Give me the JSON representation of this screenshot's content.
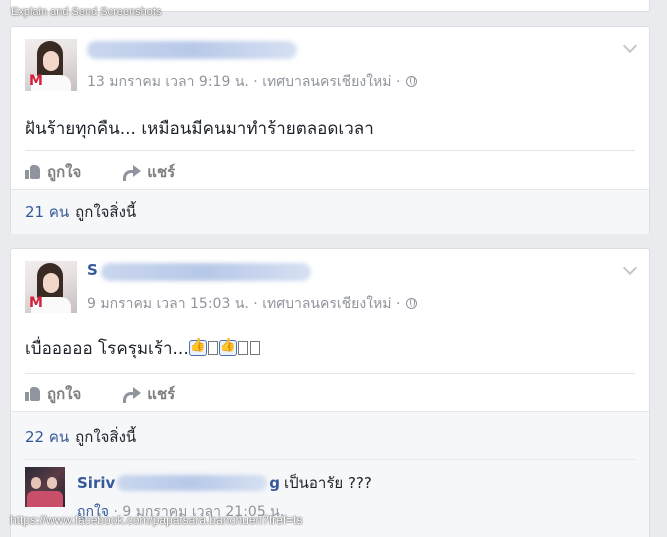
{
  "watermark": {
    "top": "Explain and Send Screenshots",
    "bottom": "https://www.facebook.com/papatsara.banchuen?fref=ts"
  },
  "post1": {
    "name_visible": "",
    "timestamp": "13 มกราคม เวลา 9:19 น.",
    "location": " · เทศบาลนครเชียงใหม่ ·",
    "text": "ฝันร้ายทุกคืน... เหมือนมีคนมาทำร้ายตลอดเวลา",
    "like_label": "ถูกใจ",
    "share_label": "แชร์",
    "likes_count": "21 คน",
    "likes_text": "ถูกใจสิ่งนี้"
  },
  "post2": {
    "name_visible": "S",
    "timestamp": "9 มกราคม เวลา 15:03 น.",
    "location": " · เทศบาลนครเชียงใหม่ ·",
    "text": "เบื่อออออ โรครุมเร้า...",
    "like_label": "ถูกใจ",
    "share_label": "แชร์",
    "likes_count": "22 คน",
    "likes_text": "ถูกใจสิ่งนี้",
    "comment": {
      "name_start": "Siriv",
      "name_end": "g",
      "text": "เป็นอารัย ???",
      "like_label": "ถูกใจ",
      "time": " · 9 มกราคม เวลา 21:05 น."
    }
  },
  "icons": {
    "like": "thumbs-up-icon",
    "share": "share-arrow-icon",
    "privacy": "globe-icon",
    "menu": "chevron-down-icon"
  },
  "colors": {
    "link": "#365899",
    "meta": "#90949c",
    "background": "#e9ebee"
  }
}
